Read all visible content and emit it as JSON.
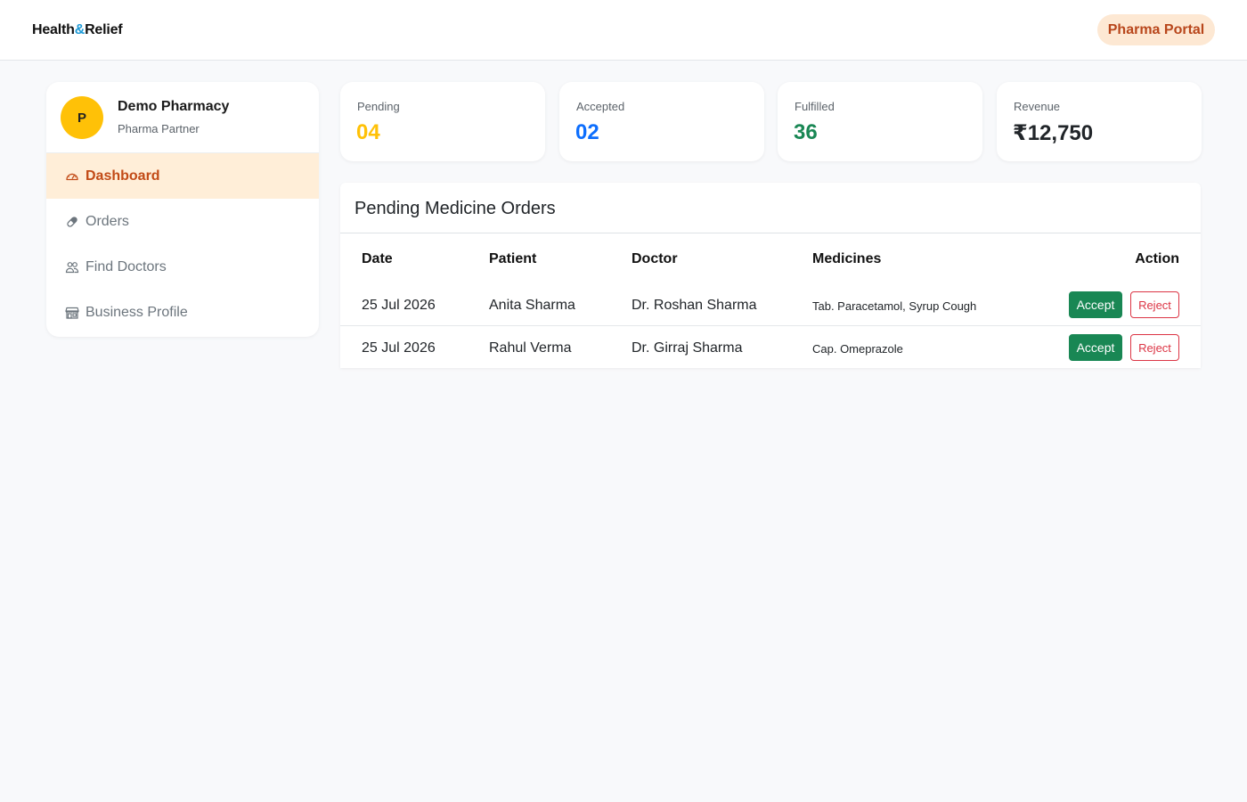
{
  "header": {
    "brand_part1": "Health",
    "brand_amp": "&",
    "brand_part2": "Relief",
    "portal_label": "Pharma Portal"
  },
  "sidebar": {
    "avatar_initial": "P",
    "name": "Demo Pharmacy",
    "role": "Pharma Partner",
    "items": [
      {
        "label": "Dashboard",
        "icon": "speedometer-icon",
        "active": true
      },
      {
        "label": "Orders",
        "icon": "capsule-icon",
        "active": false
      },
      {
        "label": "Find Doctors",
        "icon": "people-icon",
        "active": false
      },
      {
        "label": "Business Profile",
        "icon": "shop-icon",
        "active": false
      }
    ]
  },
  "stats": [
    {
      "label": "Pending",
      "value": "04",
      "color": "#ffc107"
    },
    {
      "label": "Accepted",
      "value": "02",
      "color": "#0d6efd"
    },
    {
      "label": "Fulfilled",
      "value": "36",
      "color": "#198754"
    },
    {
      "label": "Revenue",
      "value": "₹12,750",
      "color": "#212529"
    }
  ],
  "orders": {
    "title": "Pending Medicine Orders",
    "columns": [
      "Date",
      "Patient",
      "Doctor",
      "Medicines",
      "Action"
    ],
    "rows": [
      {
        "date": "25 Jul 2026",
        "patient": "Anita Sharma",
        "doctor": "Dr. Roshan Sharma",
        "medicines": "Tab. Paracetamol, Syrup Cough"
      },
      {
        "date": "25 Jul 2026",
        "patient": "Rahul Verma",
        "doctor": "Dr. Girraj Sharma",
        "medicines": "Cap. Omeprazole"
      }
    ],
    "accept_label": "Accept",
    "reject_label": "Reject"
  },
  "colors": {
    "accent": "#c24a16",
    "active_bg": "#ffeed8",
    "accept": "#198754",
    "reject": "#dc3545",
    "brand_amp": "#1f9bd7"
  }
}
